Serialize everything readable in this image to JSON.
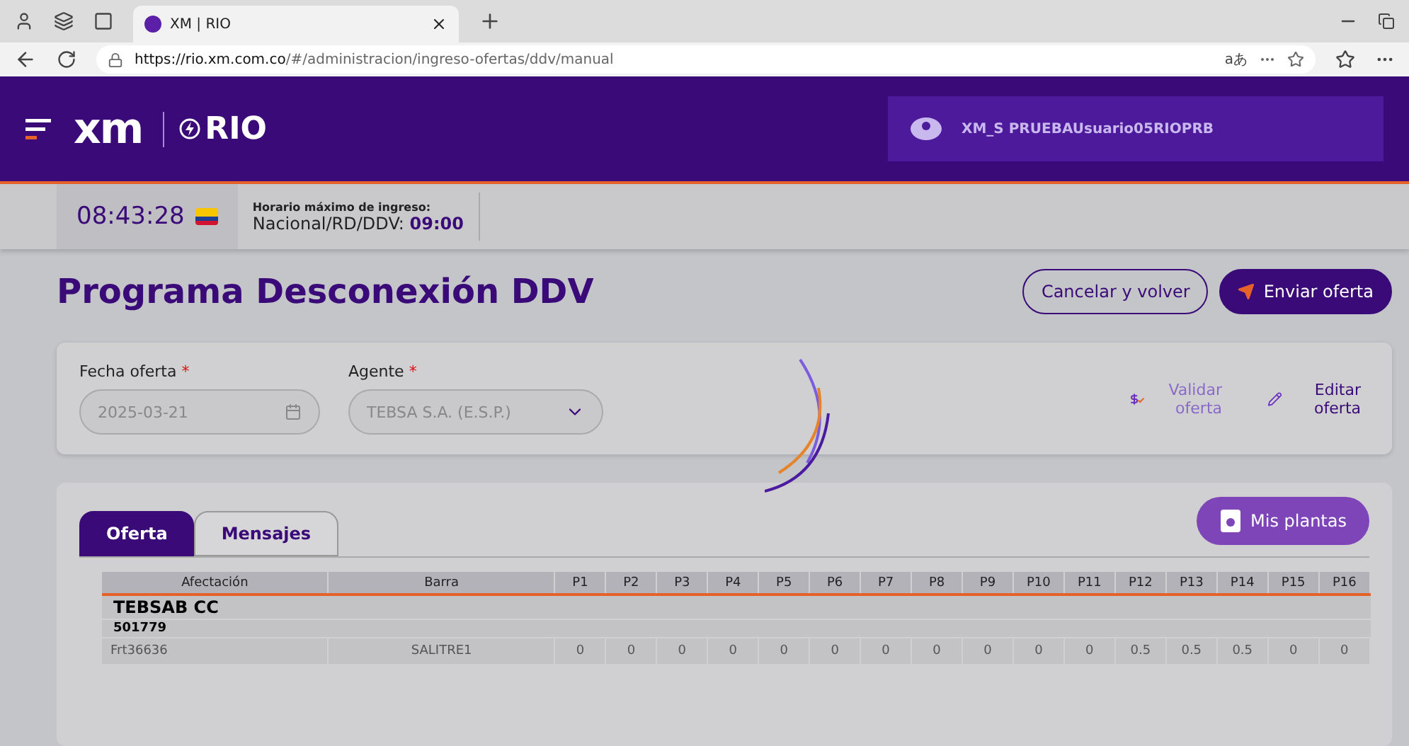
{
  "browser": {
    "tab_title": "XM | RIO",
    "url_host": "https://rio.xm.com.co",
    "url_path": "/#/administracion/ingreso-ofertas/ddv/manual",
    "reader_text": "aあ"
  },
  "header": {
    "logo": "xm",
    "app": "RIO",
    "user": "XM_S PRUEBAUsuario05RIOPRB"
  },
  "info": {
    "time": "08:43:28",
    "label": "Horario máximo de ingreso:",
    "schedule": "Nacional/RD/DDV:",
    "hour": "09:00"
  },
  "page": {
    "title": "Programa Desconexión DDV",
    "buttons": [
      {
        "label": "Cancelar y volver",
        "kind": "outline"
      },
      {
        "label": "Enviar oferta",
        "kind": "primary"
      }
    ]
  },
  "filters": {
    "fields": [
      {
        "label": "Fecha oferta",
        "required_mark": "*",
        "value": "2025-03-21",
        "kind": "date"
      },
      {
        "label": "Agente",
        "required_mark": "*",
        "value": "TEBSA S.A. (E.S.P.)",
        "kind": "select"
      }
    ],
    "actions": [
      {
        "label": "Validar oferta",
        "kind": "validate",
        "disabled": true
      },
      {
        "label": "Editar oferta",
        "kind": "edit",
        "disabled": false
      }
    ]
  },
  "tabs": [
    {
      "label": "Oferta",
      "selected": true
    },
    {
      "label": "Mensajes",
      "selected": false
    }
  ],
  "plants_button": "Mis plantas",
  "table": {
    "columns": [
      "Afectación",
      "Barra",
      "P1",
      "P2",
      "P3",
      "P4",
      "P5",
      "P6",
      "P7",
      "P8",
      "P9",
      "P10",
      "P11",
      "P12",
      "P13",
      "P14",
      "P15",
      "P16"
    ],
    "group": "TEBSAB CC",
    "subgroup": "501779",
    "rows": [
      {
        "cells": [
          "Frt36636",
          "SALITRE1",
          "0",
          "0",
          "0",
          "0",
          "0",
          "0",
          "0",
          "0",
          "0",
          "0",
          "0",
          "0.5",
          "0.5",
          "0.5",
          "0",
          "0"
        ]
      }
    ]
  }
}
